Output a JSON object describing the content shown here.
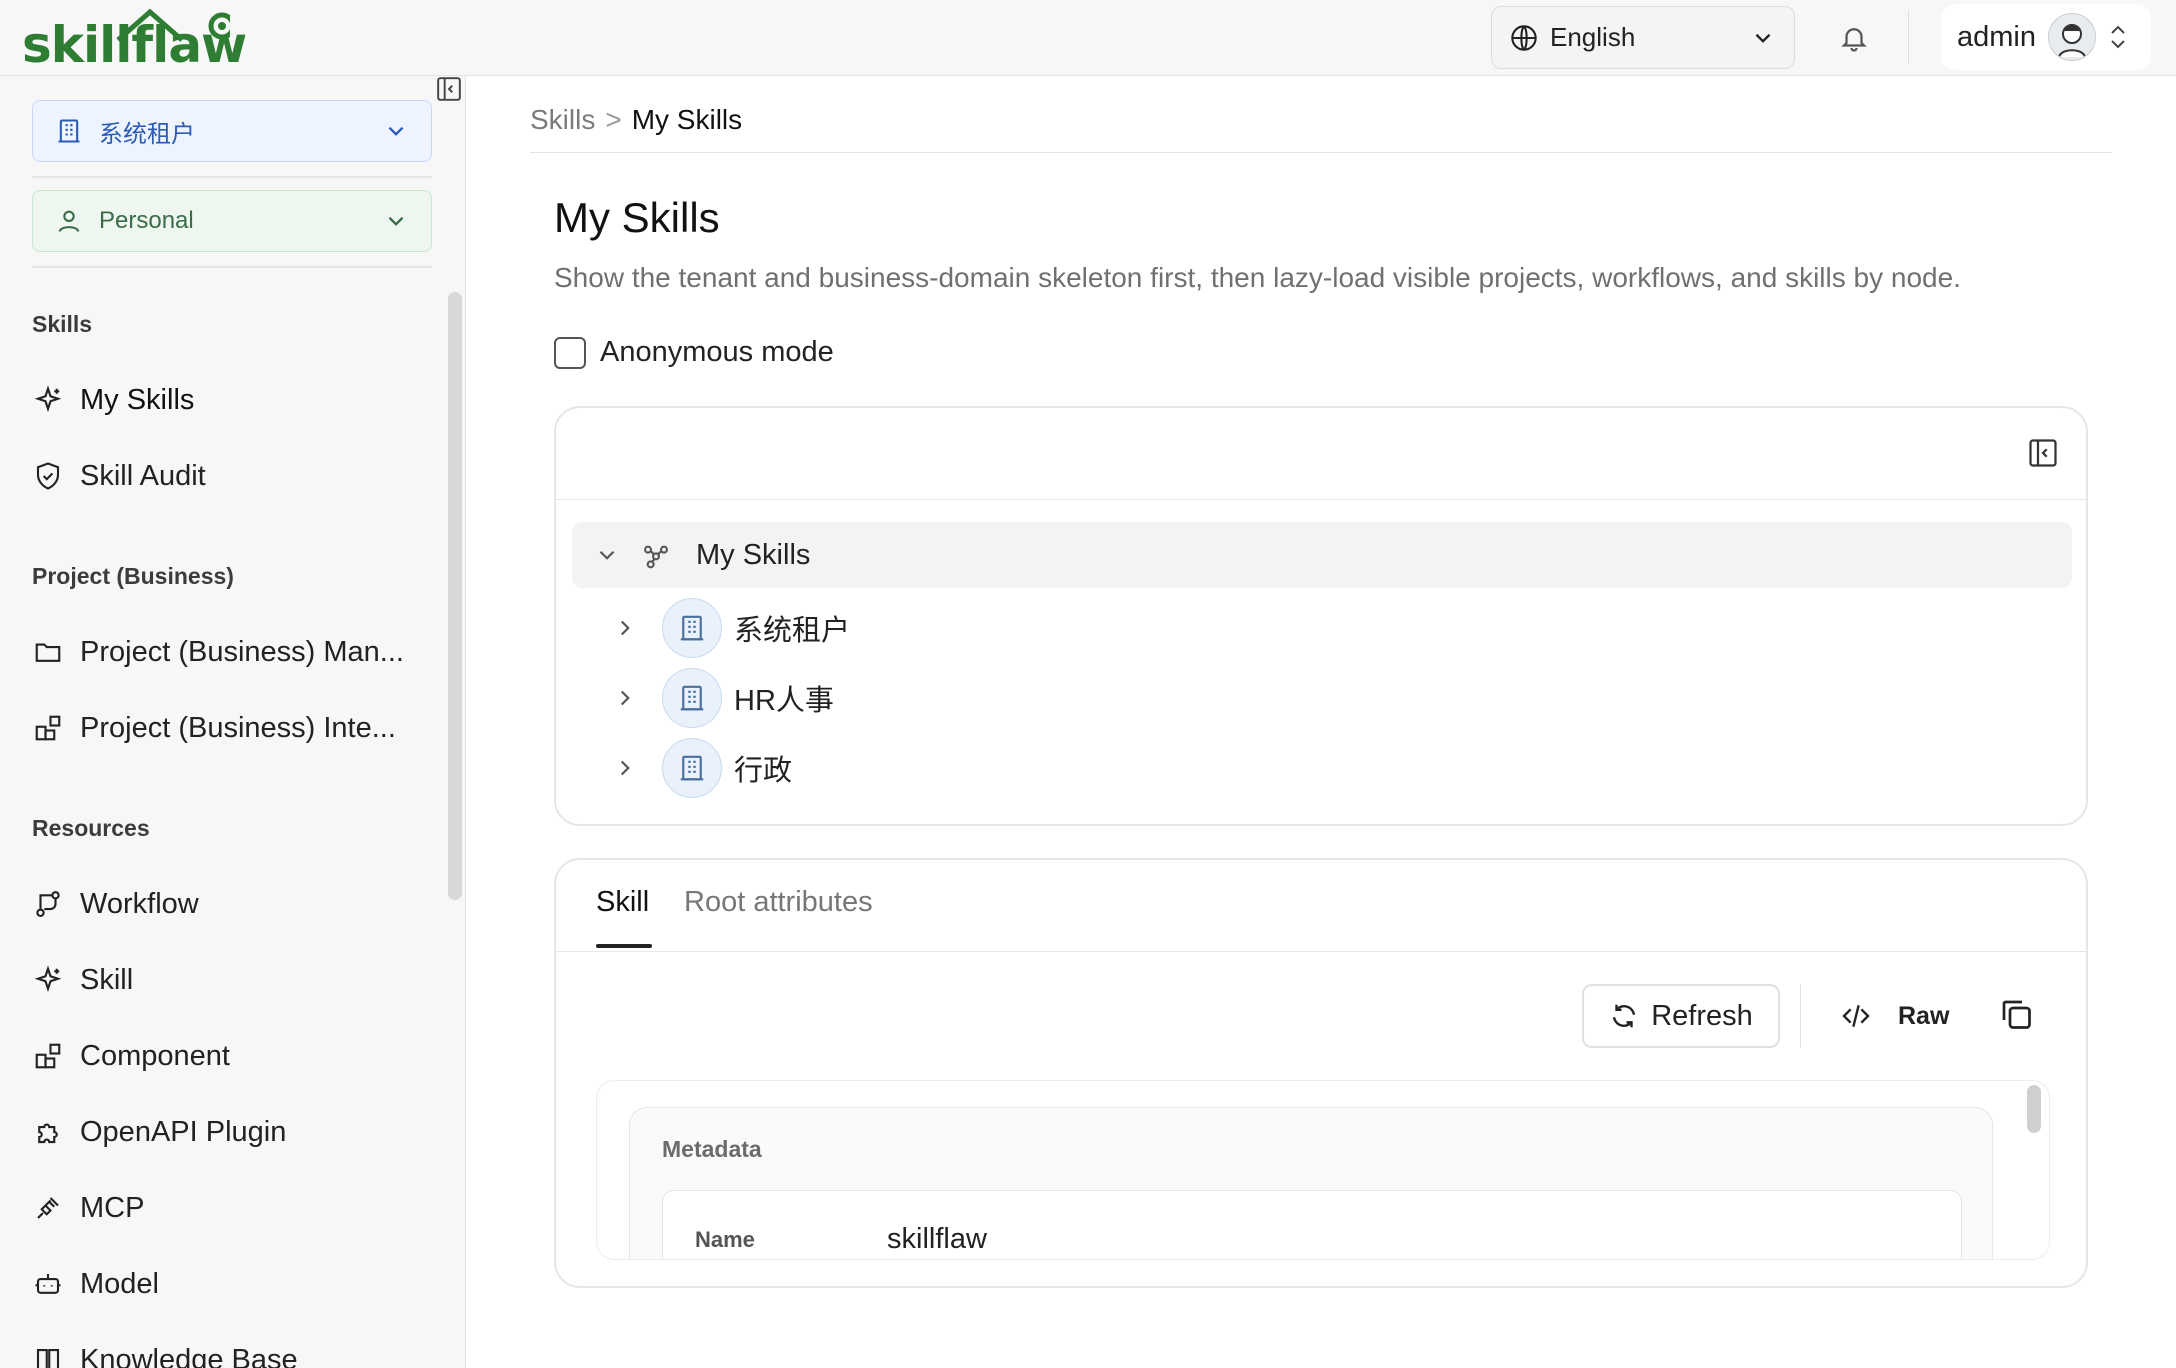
{
  "app": {
    "logo_text": "skillflaw"
  },
  "header": {
    "language": "English",
    "user_name": "admin"
  },
  "sidebar": {
    "tenant_select": "系统租户",
    "space_select": "Personal",
    "sections": [
      {
        "title": "Skills",
        "items": [
          {
            "label": "My Skills",
            "icon": "sparkle-icon"
          },
          {
            "label": "Skill Audit",
            "icon": "shield-icon"
          }
        ]
      },
      {
        "title": "Project (Business)",
        "items": [
          {
            "label": "Project (Business) Man...",
            "icon": "folder-icon"
          },
          {
            "label": "Project (Business) Inte...",
            "icon": "blocks-icon"
          }
        ]
      },
      {
        "title": "Resources",
        "items": [
          {
            "label": "Workflow",
            "icon": "workflow-icon"
          },
          {
            "label": "Skill",
            "icon": "sparkle-icon"
          },
          {
            "label": "Component",
            "icon": "blocks-icon"
          },
          {
            "label": "OpenAPI Plugin",
            "icon": "puzzle-icon"
          },
          {
            "label": "MCP",
            "icon": "plug-icon"
          },
          {
            "label": "Model",
            "icon": "bot-icon"
          },
          {
            "label": "Knowledge Base",
            "icon": "book-icon"
          }
        ]
      }
    ]
  },
  "breadcrumb": {
    "root": "Skills",
    "separator": ">",
    "current": "My Skills"
  },
  "page": {
    "title": "My Skills",
    "description": "Show the tenant and business-domain skeleton first, then lazy-load visible projects, workflows, and skills by node.",
    "anonymous_label": "Anonymous mode"
  },
  "tree": {
    "root_label": "My Skills",
    "nodes": [
      {
        "label": "系统租户"
      },
      {
        "label": "HR人事"
      },
      {
        "label": "行政"
      }
    ]
  },
  "detail": {
    "tabs": [
      "Skill",
      "Root attributes"
    ],
    "active_tab": "Skill",
    "refresh_label": "Refresh",
    "raw_label": "Raw",
    "metadata_heading": "Metadata",
    "fields": [
      {
        "key": "Name",
        "value": "skillflaw"
      }
    ]
  },
  "colors": {
    "brand_green": "#2e7d32",
    "tenant_blue": "#2b5bb5",
    "personal_green": "#3c6b47"
  }
}
